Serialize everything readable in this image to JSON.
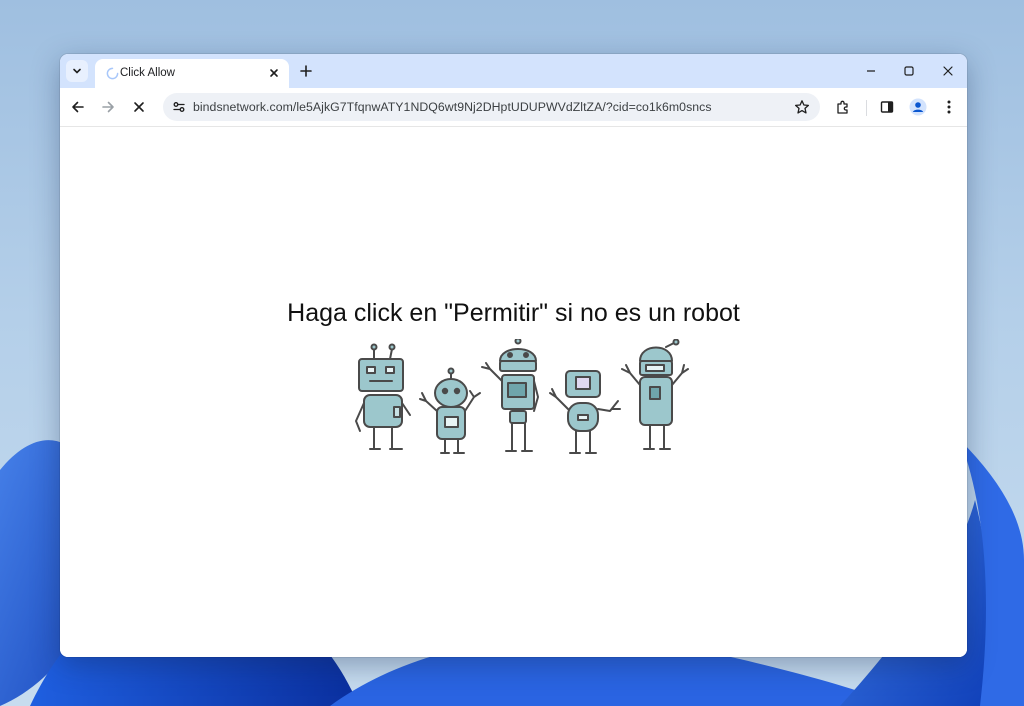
{
  "browser": {
    "tab": {
      "title": "Click Allow",
      "loading": true
    },
    "address_bar": {
      "url": "bindsnetwork.com/le5AjkG7TfqnwATY1NDQ6wt9Nj2DHptUDUPWVdZltZA/?cid=co1k6m0sncs"
    }
  },
  "page": {
    "headline": "Haga click en \"Permitir\" si no es un robot"
  },
  "icons": {
    "tab_search": "chevron-down-icon",
    "new_tab": "plus-icon",
    "minimize": "minimize-icon",
    "maximize": "maximize-icon",
    "close": "close-icon",
    "back": "back-arrow-icon",
    "forward": "forward-arrow-icon",
    "stop": "stop-icon",
    "site_info": "tune-icon",
    "bookmark": "star-icon",
    "extensions": "puzzle-icon",
    "side_panel": "side-panel-icon",
    "profile": "profile-icon",
    "menu": "kebab-menu-icon"
  },
  "colors": {
    "titlebar": "#d3e3fd",
    "robot_fill": "#9cc7cc",
    "robot_outline": "#4a4a4a"
  }
}
